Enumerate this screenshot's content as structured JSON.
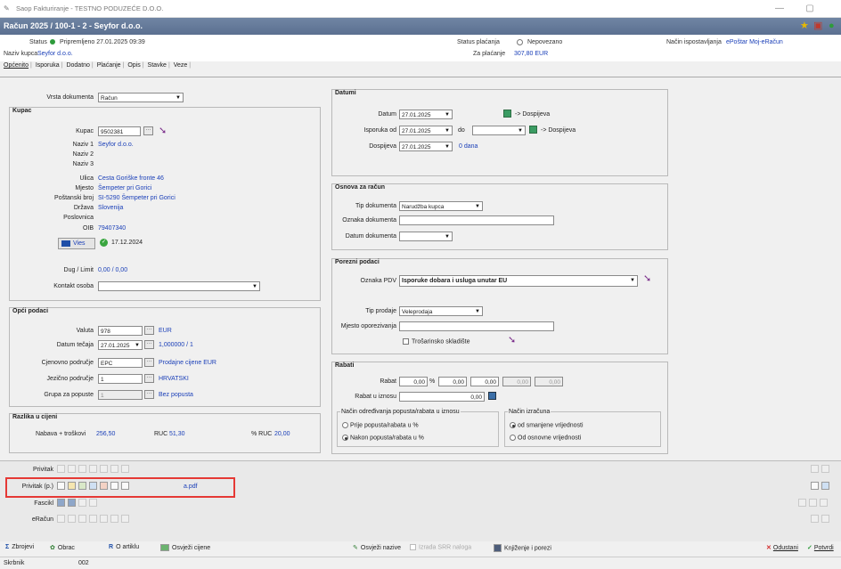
{
  "window": {
    "title": "Saop Fakturiranje - TESTNO PODUZEĆE D.O.O."
  },
  "document_bar": {
    "title": "Račun 2025 / 100-1 - 2 - Seyfor d.o.o."
  },
  "info": {
    "status_label": "Status",
    "status_value": "Pripremljeno 27.01.2025 09:39",
    "kupac_label": "Naziv kupca",
    "kupac_value": "Seyfor d.o.o.",
    "status_placanja_label": "Status plaćanja",
    "status_placanja_value": "Nepovezano",
    "za_placanje_label": "Za plaćanje",
    "za_placanje_value": "307,80 EUR",
    "nacin_label": "Način ispostavljanja",
    "nacin_value": "ePoštar Moj-eRačun"
  },
  "tabs": [
    "Općenito",
    "Isporuka",
    "Dodatno",
    "Plaćanje",
    "Opis",
    "Stavke",
    "Veze"
  ],
  "vrsta": {
    "label": "Vrsta dokumenta",
    "value": "Račun"
  },
  "kupac": {
    "title": "Kupac",
    "kupac_label": "Kupac",
    "kupac_value": "9502381",
    "naziv1_label": "Naziv 1",
    "naziv1_value": "Seyfor d.o.o.",
    "naziv2_label": "Naziv 2",
    "naziv3_label": "Naziv 3",
    "ulica_label": "Ulica",
    "ulica_value": "Cesta Goriške fronte 46",
    "mjesto_label": "Mjesto",
    "mjesto_value": "Šempeter pri Gorici",
    "posta_label": "Poštanski broj",
    "posta_value": "SI-5290   Šempeter pri Gorici",
    "drzava_label": "Država",
    "drzava_value": "Slovenija",
    "poslovnica_label": "Poslovnica",
    "oib_label": "OIB",
    "oib_value": "79407340",
    "vies_label": "Vies",
    "vies_date": "17.12.2024",
    "dug_label": "Dug / Limit",
    "dug_value": "0,00 / 0,00",
    "kontakt_label": "Kontakt osoba"
  },
  "opci": {
    "title": "Opći podaci",
    "valuta_label": "Valuta",
    "valuta_value": "978",
    "valuta_text": "EUR",
    "tecaj_label": "Datum tečaja",
    "tecaj_value": "27.01.2025",
    "tecaj_rate": "1,000000  / 1",
    "cjen_label": "Cjenovno područje",
    "cjen_value": "EPC",
    "cjen_text": "Prodajne cijene EUR",
    "jezik_label": "Jezično područje",
    "jezik_value": "1",
    "jezik_text": "HRVATSKI",
    "grupa_label": "Grupa za popuste",
    "grupa_value": "1",
    "grupa_text": "Bez popusta"
  },
  "razlika": {
    "title": "Razlika u cijeni",
    "nabava_label": "Nabava + troškovi",
    "nabava_value": "256,50",
    "ruc_label": "RUC",
    "ruc_value": "51,30",
    "pruc_label": "% RUC",
    "pruc_value": "20,00"
  },
  "datumi": {
    "title": "Datumi",
    "datum_label": "Datum",
    "datum_value": "27.01.2025",
    "dospijeva_link": "-> Dospijeva",
    "isporuka_label": "Isporuka od",
    "isporuka_value": "27.01.2025",
    "do_label": "do",
    "dospijeva_label": "Dospijeva",
    "dospijeva_value": "27.01.2025",
    "dana": "0 dana"
  },
  "osnova": {
    "title": "Osnova za račun",
    "tip_label": "Tip dokumenta",
    "tip_value": "Narudžba kupca",
    "oznaka_label": "Oznaka dokumenta",
    "datum_label": "Datum dokumenta"
  },
  "porezni": {
    "title": "Porezni podaci",
    "pdv_label": "Oznaka PDV",
    "pdv_value": "Isporuke dobara i usluga unutar EU",
    "prodaja_label": "Tip prodaje",
    "prodaja_value": "Veleprodaja",
    "mjesto_label": "Mjesto oporezivanja",
    "trosarinsko": "Trošarinsko skladište"
  },
  "rabati": {
    "title": "Rabati",
    "rabat_label": "Rabat",
    "rabat_values": [
      "0,00",
      "0,00",
      "0,00",
      "0,00",
      "0,00"
    ],
    "pct": "%",
    "iznos_label": "Rabat u iznosu",
    "iznos_value": "0,00",
    "nacin_title": "Način određivanja popusta/rabata u iznosu",
    "opt1": "Prije popusta/rabata u %",
    "opt2": "Nakon popusta/rabata u %",
    "izracun_title": "Način izračuna",
    "opt3": "od smanjene vrijednosti",
    "opt4": "Od osnovne vrijednosti"
  },
  "attachments": {
    "privitak": "Privitak",
    "privitak_p": "Privitak (p.)",
    "file": "a.pdf",
    "fascikl": "Fascikl",
    "eracun": "eRačun"
  },
  "toolbar": {
    "zbrojevi": "Zbrojevi",
    "obrac": "Obrac",
    "oartiklu": "O artiklu",
    "cijene": "Osvježi cijene",
    "nazive": "Osvježi nazive",
    "izrada": "Izrada SRR naloga",
    "knjizenje": "Knjiženje i porezi",
    "odustani": "Odustani",
    "potvrdi": "Potvrdi"
  },
  "statusbar": {
    "left": "Skrbnik",
    "code": "002"
  },
  "colors": {
    "accent_blue": "#1a3fb8",
    "titlebar": "#5b7091",
    "status_green": "#2e9b3b",
    "highlight_red": "#e53935"
  }
}
